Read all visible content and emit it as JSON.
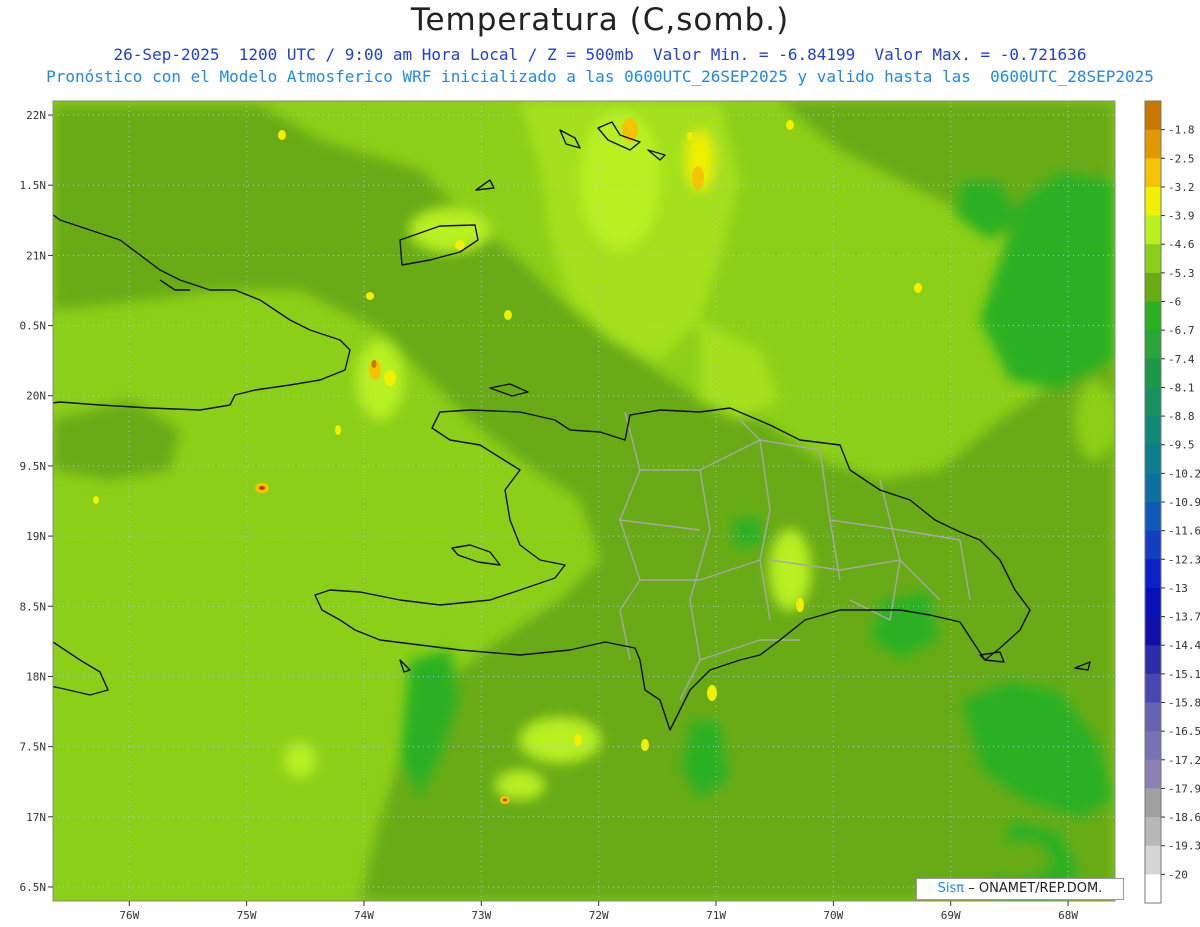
{
  "title": "Temperatura (C,somb.)",
  "subtitle_line1": "26-Sep-2025  1200 UTC / 9:00 am Hora Local / Z = 500mb  Valor Min. = -6.84199  Valor Max. = -0.721636",
  "subtitle_line2": "Pronóstico con el Modelo Atmosferico WRF inicializado a las 0600UTC_26SEP2025 y valido hasta las  0600UTC_28SEP2025",
  "credit": {
    "brand": "Sisπ",
    "text": "– ONAMET/REP.DOM."
  },
  "colors": {
    "base_field": "#8ccf18",
    "land_border": "#111111",
    "province_border": "#a8a8a8",
    "grid": "#aac8e0"
  },
  "chart_data": {
    "type": "heatmap",
    "lon_ticks": [
      "76W",
      "75W",
      "74W",
      "73W",
      "72W",
      "71W",
      "70W",
      "69W",
      "68W"
    ],
    "lat_ticks": [
      "22N",
      "1.5N",
      "21N",
      "0.5N",
      "20N",
      "9.5N",
      "19N",
      "8.5N",
      "18N",
      "7.5N",
      "17N",
      "6.5N"
    ],
    "lon_range": [
      -76.65,
      -67.6
    ],
    "lat_range": [
      16.4,
      22.1
    ],
    "colorbar": {
      "labels": [
        "-1.8",
        "-2.5",
        "-3.2",
        "-3.9",
        "-4.6",
        "-5.3",
        "-6",
        "-6.7",
        "-7.4",
        "-8.1",
        "-8.8",
        "-9.5",
        "-10.2",
        "-10.9",
        "-11.6",
        "-12.3",
        "-13",
        "-13.7",
        "-14.4",
        "-15.1",
        "-15.8",
        "-16.5",
        "-17.2",
        "-17.9",
        "-18.6",
        "-19.3",
        "-20"
      ],
      "colors": [
        "#c87800",
        "#e09a00",
        "#f5c400",
        "#f0f000",
        "#b8f020",
        "#8ccf18",
        "#68ab12",
        "#2ab020",
        "#28a438",
        "#1c9848",
        "#1a9060",
        "#108878",
        "#0c7e8c",
        "#0c70a0",
        "#1058b8",
        "#1040c0",
        "#0c20c8",
        "#0a10b8",
        "#1010a8",
        "#2c2ca8",
        "#4848b0",
        "#6464b0",
        "#7a70b4",
        "#8e80b4",
        "#a0a0a0",
        "#b8b8b8",
        "#d6d6d6",
        "#ffffff"
      ]
    }
  }
}
